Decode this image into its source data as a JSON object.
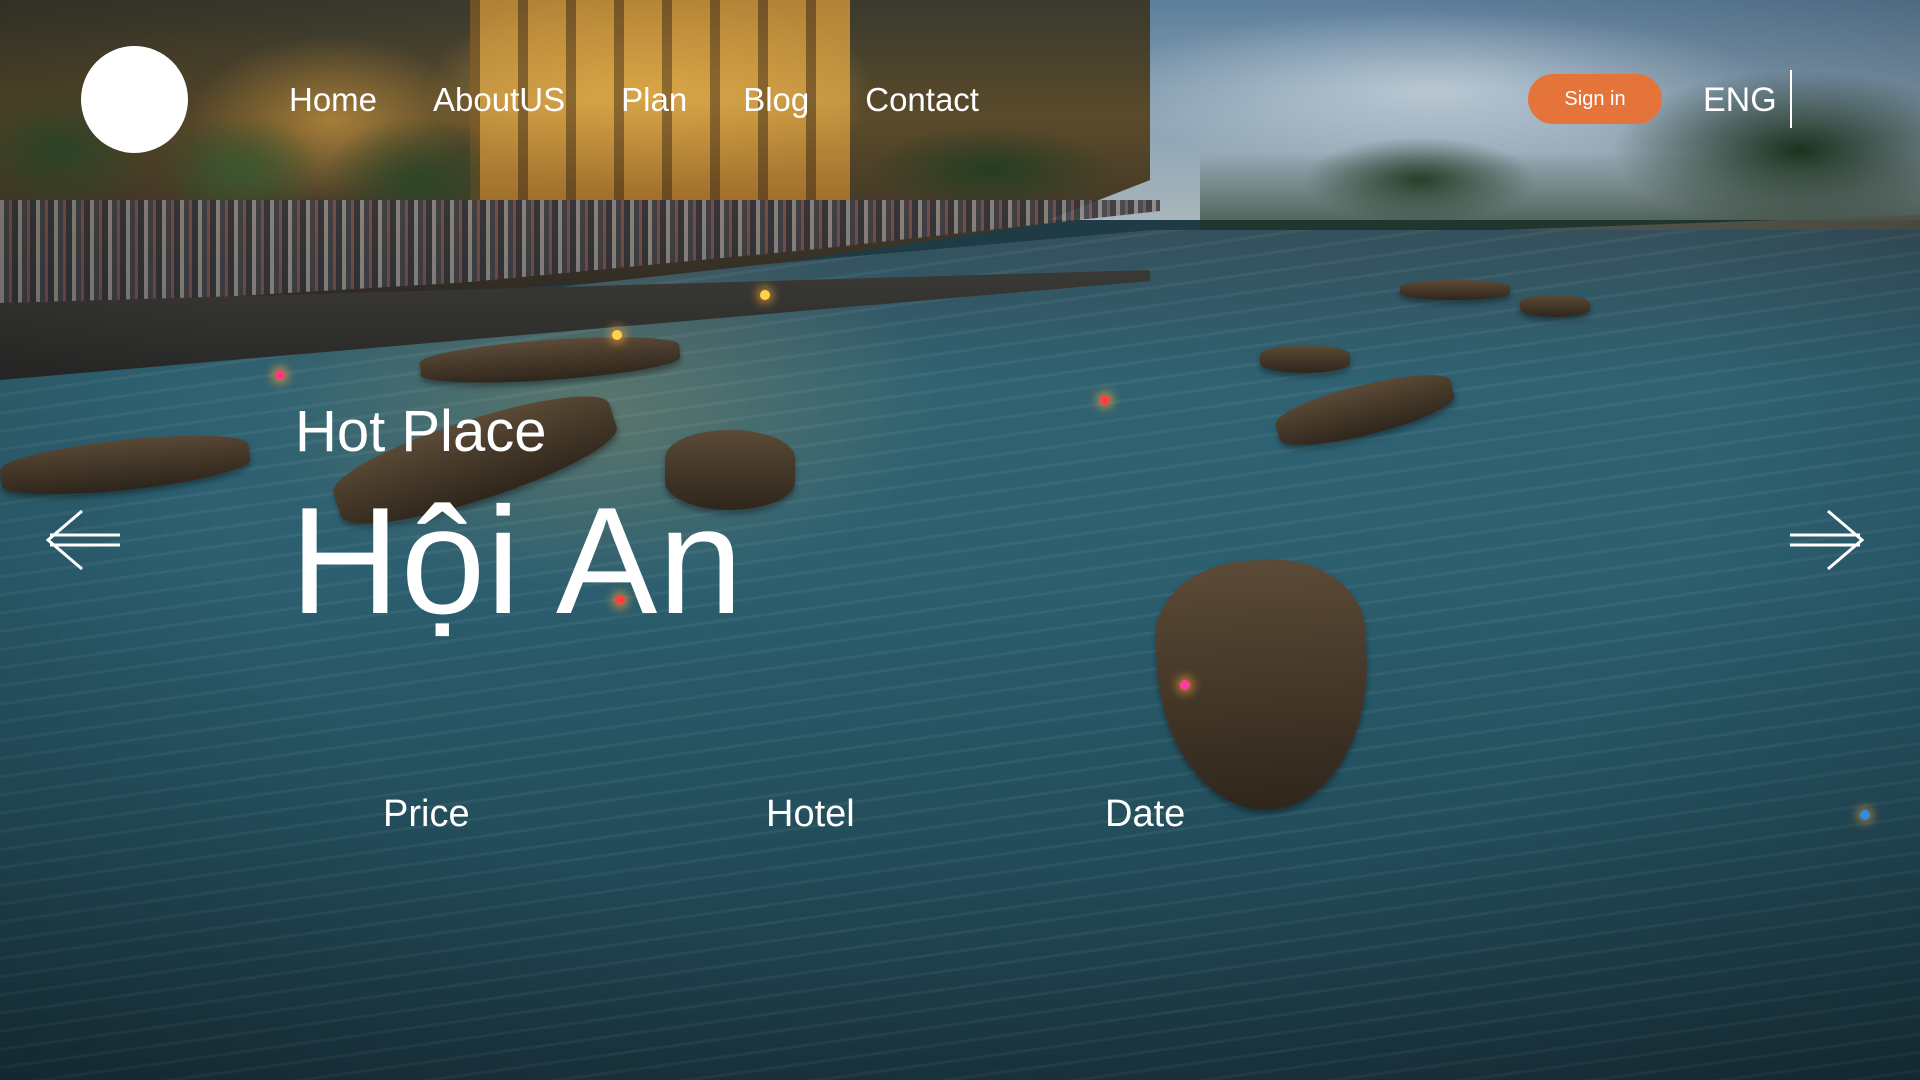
{
  "nav": {
    "items": [
      {
        "label": "Home"
      },
      {
        "label": "AboutUS"
      },
      {
        "label": "Plan"
      },
      {
        "label": "Blog"
      },
      {
        "label": "Contact"
      }
    ]
  },
  "header": {
    "signin_label": "Sign in",
    "language": "ENG"
  },
  "hero": {
    "subtitle": "Hot Place",
    "title": "Hội An"
  },
  "filters": {
    "price": "Price",
    "hotel": "Hotel",
    "date": "Date"
  },
  "icons": {
    "prev": "arrow-left-icon",
    "next": "arrow-right-icon"
  },
  "colors": {
    "accent": "#e5743a",
    "text": "#ffffff"
  }
}
